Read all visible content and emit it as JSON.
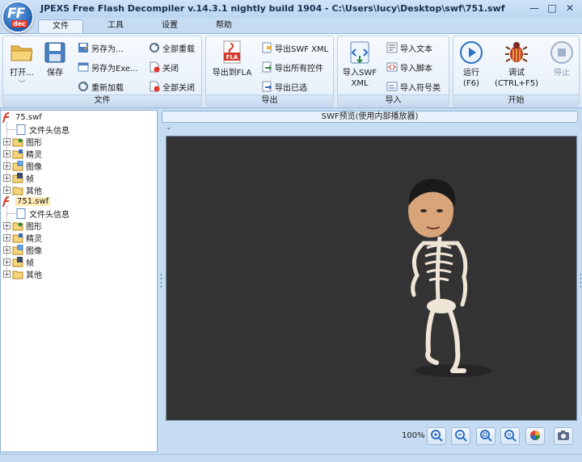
{
  "window": {
    "title": "JPEXS Free Flash Decompiler v.14.3.1 nightly build 1904 - C:\\Users\\lucy\\Desktop\\swf\\751.swf",
    "logo_main": "FF",
    "logo_sub": "dec",
    "minimize_glyph": "—",
    "maximize_glyph": "□",
    "close_glyph": "✕"
  },
  "menu_tabs": [
    "文件",
    "工具",
    "设置",
    "帮助"
  ],
  "ribbon": {
    "file_group": {
      "label": "文件",
      "open": "打开...",
      "open_arrow": "﹀",
      "save": "保存",
      "save_as": "另存为...",
      "save_as_exe": "另存为Exe...",
      "reload": "重新加载",
      "reload_all": "全部重载",
      "close": "关闭",
      "close_all": "全部关闭"
    },
    "export_group": {
      "label": "导出",
      "export_fla_line1": "导出到FLA",
      "fla_badge": "FLA",
      "export_swf_xml": "导出SWF XML",
      "export_all": "导出所有控件",
      "export_selected": "导出已选"
    },
    "import_group": {
      "label": "导入",
      "import_swf_xml_line1": "导入SWF",
      "import_swf_xml_line2": "XML",
      "import_text": "导入文本",
      "import_script": "导入脚本",
      "import_symbols": "导入符号类"
    },
    "start_group": {
      "label": "开始",
      "run_line1": "运行",
      "run_line2": "(F6)",
      "debug_line1": "调试",
      "debug_line2": "(CTRL+F5)",
      "stop": "停止"
    }
  },
  "tree": {
    "files": [
      {
        "name": "75.swf",
        "children": [
          "文件头信息",
          "图形",
          "精灵",
          "图像",
          "帧",
          "其他"
        ]
      },
      {
        "name": "751.swf",
        "children": [
          "文件头信息",
          "图形",
          "精灵",
          "图像",
          "帧",
          "其他"
        ]
      }
    ],
    "expander_glyph": "+"
  },
  "preview": {
    "header": "SWF预览(使用内部播放器)",
    "dash": "-",
    "zoom": "100%"
  },
  "colors": {
    "stage_bg": "#333333",
    "accent": "#1d5fb0",
    "selection": "#fdeab5"
  }
}
